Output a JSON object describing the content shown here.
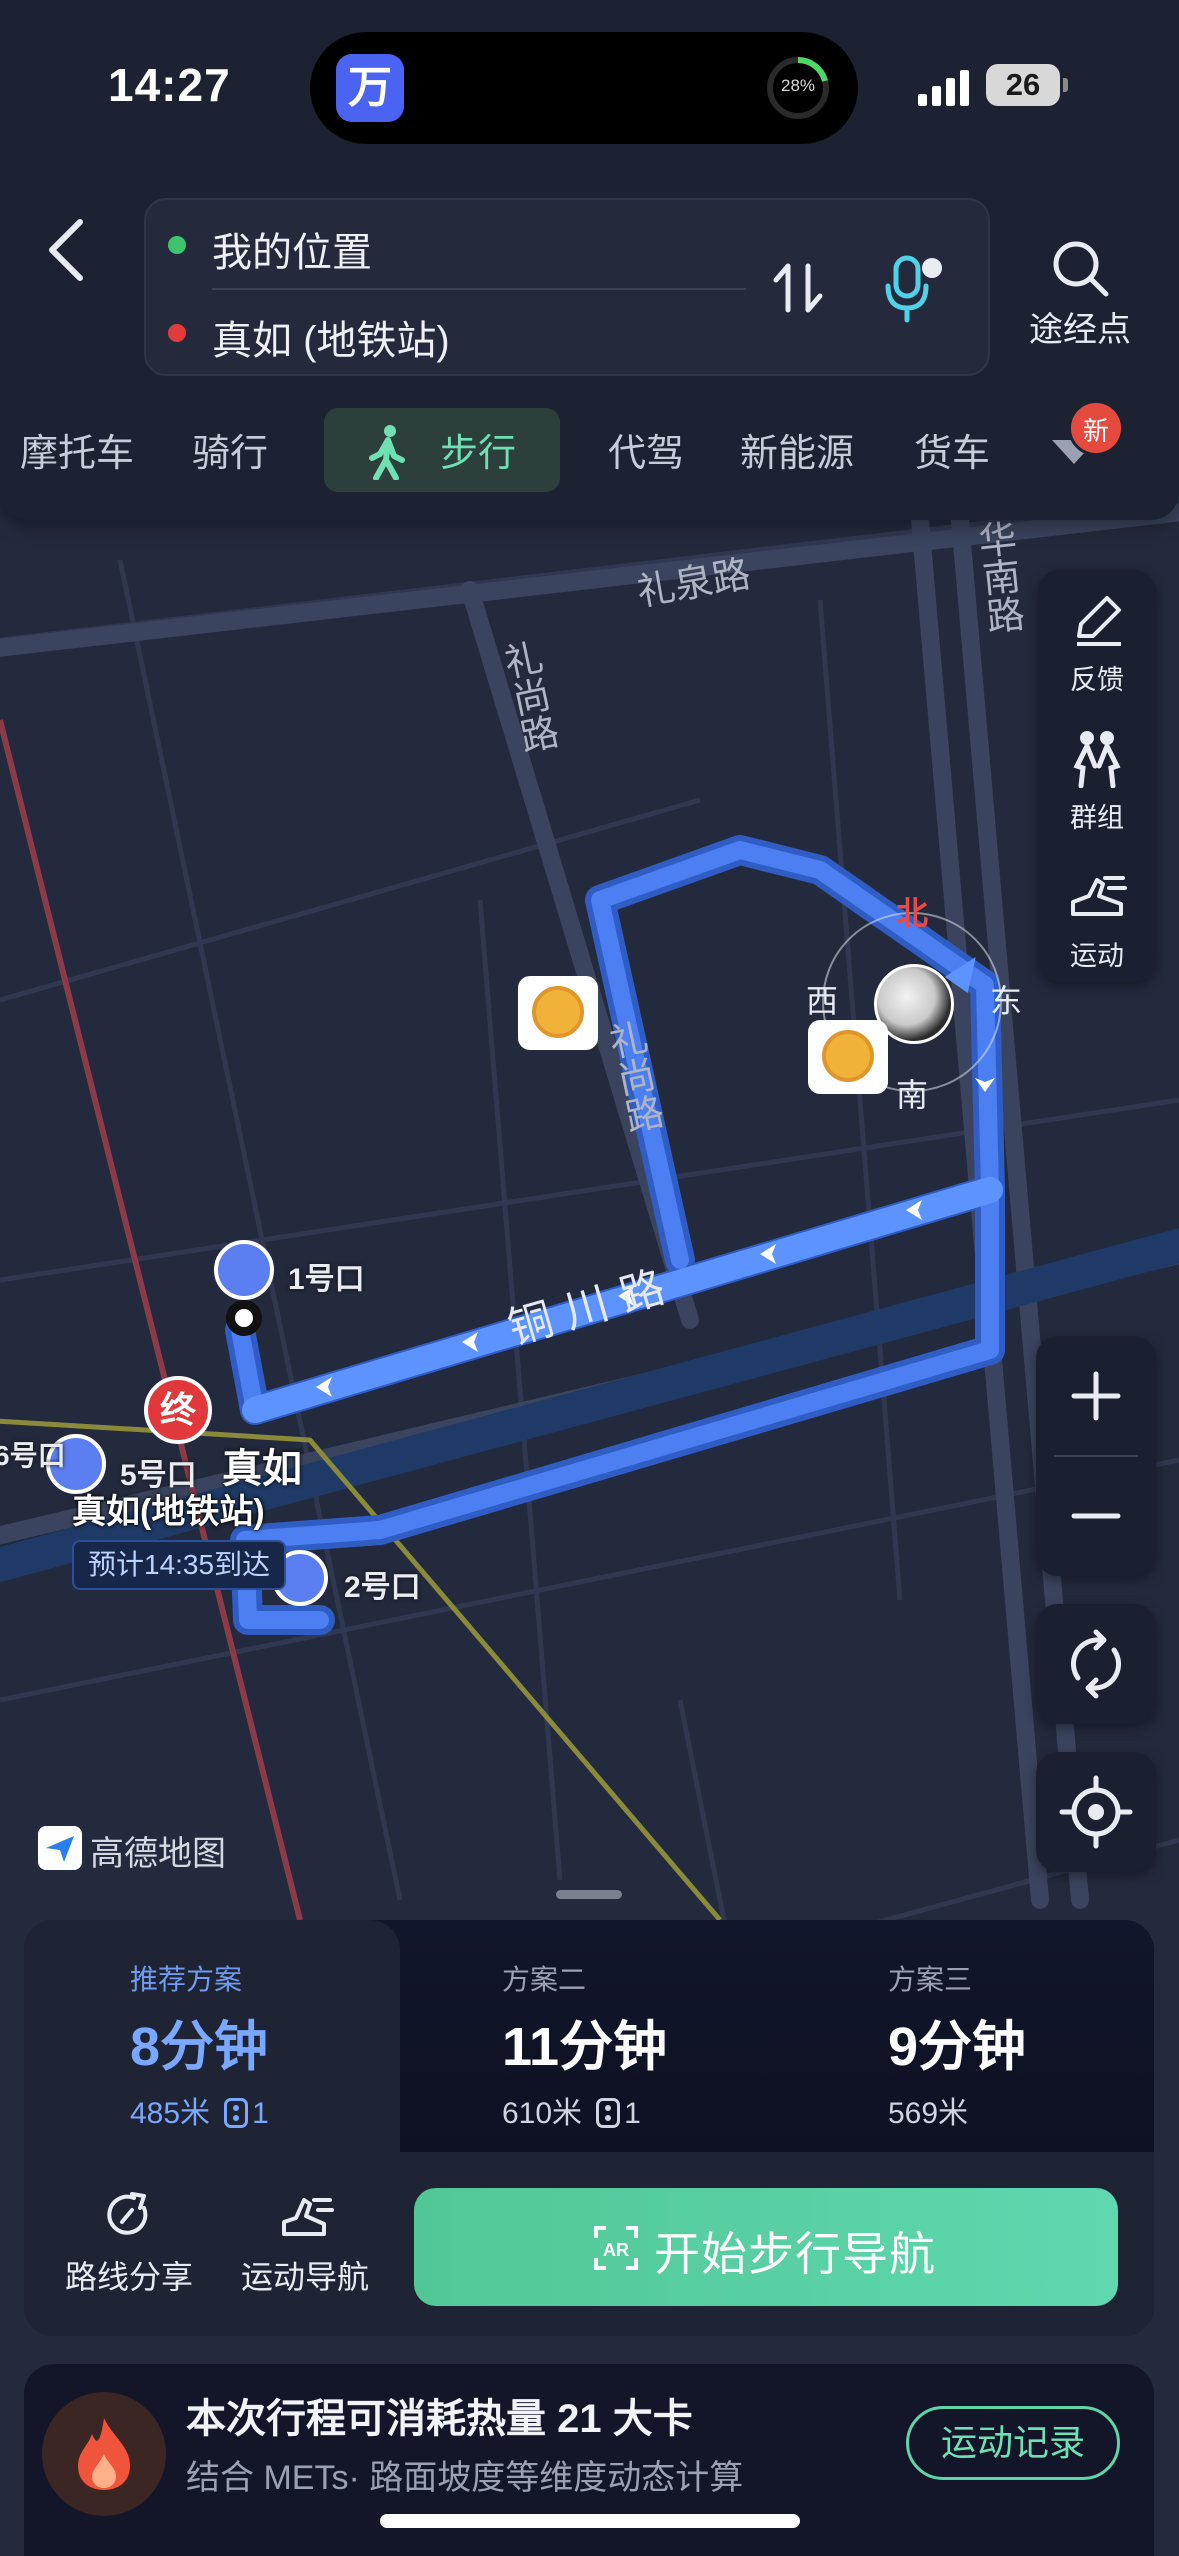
{
  "status_bar": {
    "time": "14:27",
    "ring_percent": "28%",
    "battery": "26"
  },
  "island": {
    "app_icon_char": "万"
  },
  "route": {
    "from": "我的位置",
    "to": "真如 (地铁站)",
    "waypoint_label": "途经点"
  },
  "modes": {
    "moto": "摩托车",
    "ride": "骑行",
    "walk": "步行",
    "drive_service": "代驾",
    "ev": "新能源",
    "truck": "货车",
    "new_badge": "新"
  },
  "side_tools": {
    "feedback": "反馈",
    "group": "群组",
    "sport": "运动"
  },
  "map": {
    "roads": {
      "liquan": "礼泉路",
      "lishang_top": "礼尚路",
      "lishang_mid": "礼尚路",
      "huanan": "华南路",
      "tongchuan": "铜川路"
    },
    "compass": {
      "north": "北",
      "east": "东",
      "south": "南",
      "west": "西"
    },
    "exits": {
      "exit1": "1号口",
      "exit2": "2号口",
      "exit5": "5号口",
      "exit6": "6号口"
    },
    "end_pin": "终",
    "station_short": "真如",
    "station_name": "真如(地铁站)",
    "eta": "预计14:35到达",
    "logo": "高德地图"
  },
  "plans": [
    {
      "tag": "推荐方案",
      "duration": "8分钟",
      "distance": "485米",
      "lights": "1"
    },
    {
      "tag": "方案二",
      "duration": "11分钟",
      "distance": "610米",
      "lights": "1"
    },
    {
      "tag": "方案三",
      "duration": "9分钟",
      "distance": "569米"
    }
  ],
  "actions": {
    "share": "路线分享",
    "sport_nav": "运动导航",
    "start": "开始步行导航"
  },
  "calorie": {
    "title": "本次行程可消耗热量 21 大卡",
    "subtitle": "结合 METs· 路面坡度等维度动态计算",
    "record": "运动记录"
  },
  "colors": {
    "route": "#4e7ff5",
    "accent_green": "#5fd8b0",
    "start_red": "#e23b3b"
  }
}
